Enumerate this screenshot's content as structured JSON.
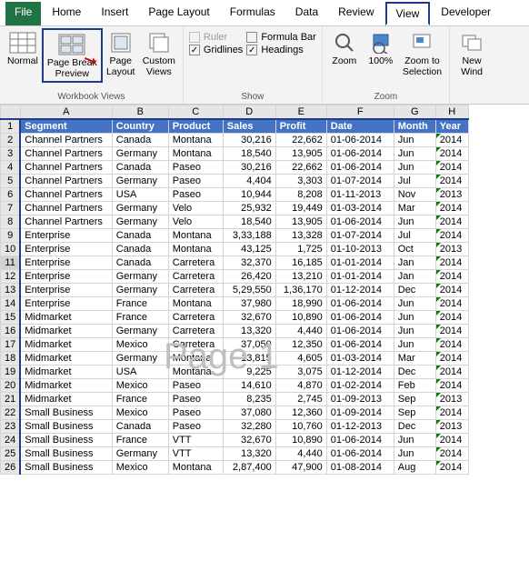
{
  "tabs": [
    "File",
    "Home",
    "Insert",
    "Page Layout",
    "Formulas",
    "Data",
    "Review",
    "View",
    "Developer"
  ],
  "active_tab": "View",
  "ribbon": {
    "views_group": "Workbook Views",
    "show_group": "Show",
    "zoom_group": "Zoom",
    "normal": "Normal",
    "pagebreak": "Page Break\nPreview",
    "pagelayout": "Page\nLayout",
    "customviews": "Custom\nViews",
    "ruler": "Ruler",
    "gridlines": "Gridlines",
    "formulabar": "Formula Bar",
    "headings": "Headings",
    "zoom": "Zoom",
    "z100": "100%",
    "zoomsel": "Zoom to\nSelection",
    "newwin": "New\nWind"
  },
  "watermark": "Page 1",
  "colheads": [
    "A",
    "B",
    "C",
    "D",
    "E",
    "F",
    "G",
    "H"
  ],
  "headers": [
    "Segment",
    "Country",
    "Product",
    "Sales",
    "Profit",
    "Date",
    "Month",
    "Year"
  ],
  "rows": [
    [
      "Channel Partners",
      "Canada",
      "Montana",
      "30,216",
      "22,662",
      "01-06-2014",
      "Jun",
      "2014"
    ],
    [
      "Channel Partners",
      "Germany",
      "Montana",
      "18,540",
      "13,905",
      "01-06-2014",
      "Jun",
      "2014"
    ],
    [
      "Channel Partners",
      "Canada",
      "Paseo",
      "30,216",
      "22,662",
      "01-06-2014",
      "Jun",
      "2014"
    ],
    [
      "Channel Partners",
      "Germany",
      "Paseo",
      "4,404",
      "3,303",
      "01-07-2014",
      "Jul",
      "2014"
    ],
    [
      "Channel Partners",
      "USA",
      "Paseo",
      "10,944",
      "8,208",
      "01-11-2013",
      "Nov",
      "2013"
    ],
    [
      "Channel Partners",
      "Germany",
      "Velo",
      "25,932",
      "19,449",
      "01-03-2014",
      "Mar",
      "2014"
    ],
    [
      "Channel Partners",
      "Germany",
      "Velo",
      "18,540",
      "13,905",
      "01-06-2014",
      "Jun",
      "2014"
    ],
    [
      "Enterprise",
      "Canada",
      "Montana",
      "3,33,188",
      "13,328",
      "01-07-2014",
      "Jul",
      "2014"
    ],
    [
      "Enterprise",
      "Canada",
      "Montana",
      "43,125",
      "1,725",
      "01-10-2013",
      "Oct",
      "2013"
    ],
    [
      "Enterprise",
      "Canada",
      "Carretera",
      "32,370",
      "16,185",
      "01-01-2014",
      "Jan",
      "2014"
    ],
    [
      "Enterprise",
      "Germany",
      "Carretera",
      "26,420",
      "13,210",
      "01-01-2014",
      "Jan",
      "2014"
    ],
    [
      "Enterprise",
      "Germany",
      "Carretera",
      "5,29,550",
      "1,36,170",
      "01-12-2014",
      "Dec",
      "2014"
    ],
    [
      "Enterprise",
      "France",
      "Montana",
      "37,980",
      "18,990",
      "01-06-2014",
      "Jun",
      "2014"
    ],
    [
      "Midmarket",
      "France",
      "Carretera",
      "32,670",
      "10,890",
      "01-06-2014",
      "Jun",
      "2014"
    ],
    [
      "Midmarket",
      "Germany",
      "Carretera",
      "13,320",
      "4,440",
      "01-06-2014",
      "Jun",
      "2014"
    ],
    [
      "Midmarket",
      "Mexico",
      "Carretera",
      "37,050",
      "12,350",
      "01-06-2014",
      "Jun",
      "2014"
    ],
    [
      "Midmarket",
      "Germany",
      "Montana",
      "13,815",
      "4,605",
      "01-03-2014",
      "Mar",
      "2014"
    ],
    [
      "Midmarket",
      "USA",
      "Montana",
      "9,225",
      "3,075",
      "01-12-2014",
      "Dec",
      "2014"
    ],
    [
      "Midmarket",
      "Mexico",
      "Paseo",
      "14,610",
      "4,870",
      "01-02-2014",
      "Feb",
      "2014"
    ],
    [
      "Midmarket",
      "France",
      "Paseo",
      "8,235",
      "2,745",
      "01-09-2013",
      "Sep",
      "2013"
    ],
    [
      "Small Business",
      "Mexico",
      "Paseo",
      "37,080",
      "12,360",
      "01-09-2014",
      "Sep",
      "2014"
    ],
    [
      "Small Business",
      "Canada",
      "Paseo",
      "32,280",
      "10,760",
      "01-12-2013",
      "Dec",
      "2013"
    ],
    [
      "Small Business",
      "France",
      "VTT",
      "32,670",
      "10,890",
      "01-06-2014",
      "Jun",
      "2014"
    ],
    [
      "Small Business",
      "Germany",
      "VTT",
      "13,320",
      "4,440",
      "01-06-2014",
      "Jun",
      "2014"
    ],
    [
      "Small Business",
      "Mexico",
      "Montana",
      "2,87,400",
      "47,900",
      "01-08-2014",
      "Aug",
      "2014"
    ]
  ],
  "selrow": 11
}
